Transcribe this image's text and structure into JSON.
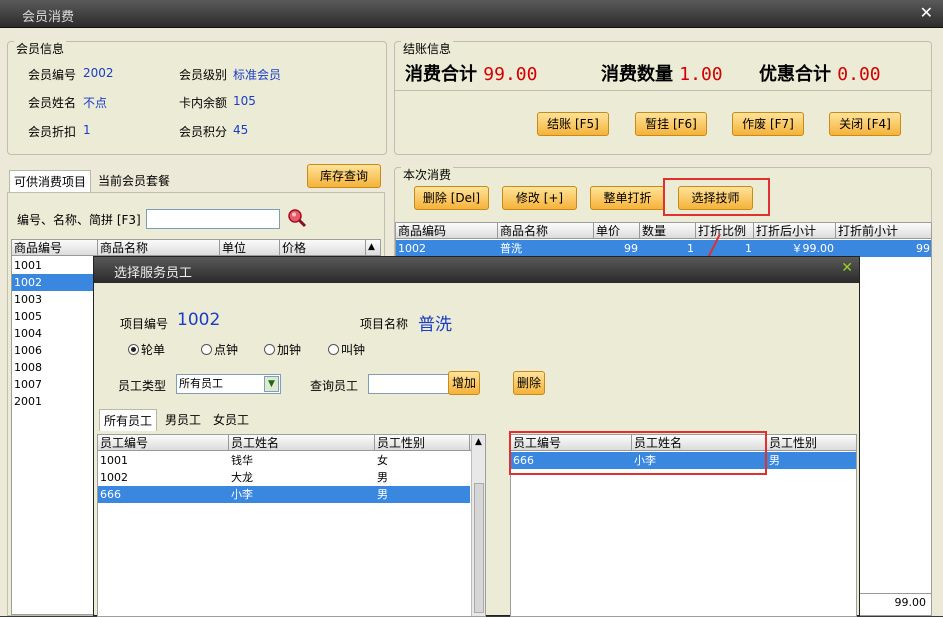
{
  "window": {
    "title": "会员消费"
  },
  "member": {
    "group_title": "会员信息",
    "no_label": "会员编号",
    "no": "2002",
    "level_label": "会员级别",
    "level": "标准会员",
    "name_label": "会员姓名",
    "name": "不点",
    "balance_label": "卡内余额",
    "balance": "105",
    "discount_label": "会员折扣",
    "discount": "1",
    "points_label": "会员积分",
    "points": "45"
  },
  "checkout": {
    "group_title": "结账信息",
    "total_label": "消费合计",
    "total": "99.00",
    "qty_label": "消费数量",
    "qty": "1.00",
    "disc_label": "优惠合计",
    "disc": "0.00",
    "buttons": [
      "结账 [F5]",
      "暂挂 [F6]",
      "作废 [F7]",
      "关闭 [F4]"
    ]
  },
  "left": {
    "tabs": [
      "可供消费项目",
      "当前会员套餐"
    ],
    "stock_button": "库存查询",
    "search_label": "编号、名称、简拼 [F3]",
    "search_value": "",
    "columns": [
      "商品编号",
      "商品名称",
      "单位",
      "价格"
    ],
    "rows": [
      "1001",
      "1002",
      "1003",
      "1005",
      "1004",
      "1006",
      "1008",
      "1007",
      "2001"
    ],
    "selected_index": 1
  },
  "current": {
    "group_title": "本次消费",
    "buttons": [
      "删除 [Del]",
      "修改 [+]",
      "整单打折",
      "选择技师"
    ],
    "columns": [
      "商品编码",
      "商品名称",
      "单价",
      "数量",
      "打折比例",
      "打折后小计",
      "打折前小计"
    ],
    "row": [
      "1002",
      "普洗",
      "99",
      "1",
      "1",
      "￥99.00",
      "99"
    ],
    "footer_total": "99.00"
  },
  "dialog": {
    "title": "选择服务员工",
    "item_no_label": "项目编号",
    "item_no": "1002",
    "item_name_label": "项目名称",
    "item_name": "普洗",
    "radios": [
      "轮单",
      "点钟",
      "加钟",
      "叫钟"
    ],
    "radio_selected": 0,
    "type_label": "员工类型",
    "type_value": "所有员工",
    "query_label": "查询员工",
    "query_value": "",
    "add_button": "增加",
    "delete_button": "删除",
    "tabs": [
      "所有员工",
      "男员工",
      "女员工"
    ],
    "left_columns": [
      "员工编号",
      "员工姓名",
      "员工性别"
    ],
    "left_rows": [
      [
        "1001",
        "钱华",
        "女"
      ],
      [
        "1002",
        "大龙",
        "男"
      ],
      [
        "666",
        "小李",
        "男"
      ]
    ],
    "left_selected": 2,
    "right_columns": [
      "员工编号",
      "员工姓名",
      "员工性别"
    ],
    "right_rows": [
      [
        "666",
        "小李",
        "男"
      ]
    ],
    "close_icon": "close-icon"
  },
  "colors": {
    "accent": "#d40000",
    "selection": "#3a87e0",
    "highlight": "#e03030",
    "button": "#f5b23a"
  }
}
